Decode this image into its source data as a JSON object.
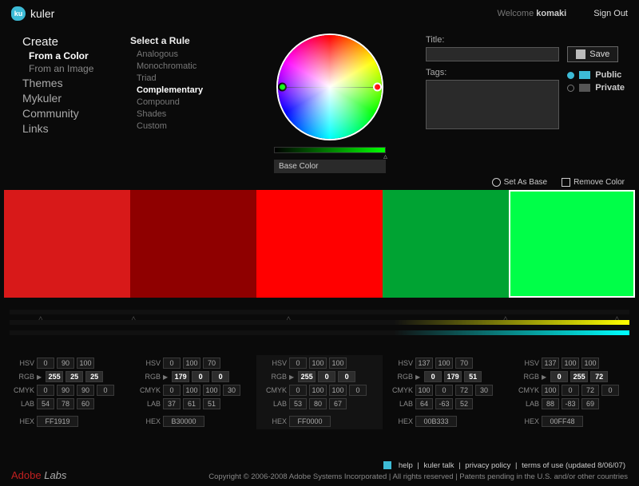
{
  "app": {
    "badge": "ku",
    "name": "kuler"
  },
  "user": {
    "welcome": "Welcome",
    "name": "komaki",
    "signout": "Sign Out"
  },
  "nav": {
    "create": "Create",
    "from_color": "From a Color",
    "from_image": "From an Image",
    "themes": "Themes",
    "mykuler": "Mykuler",
    "community": "Community",
    "links": "Links"
  },
  "rules": {
    "title": "Select a Rule",
    "items": [
      "Analogous",
      "Monochromatic",
      "Triad",
      "Complementary",
      "Compound",
      "Shades",
      "Custom"
    ],
    "active": 3
  },
  "base_color_label": "Base Color",
  "meta": {
    "title_label": "Title:",
    "tags_label": "Tags:",
    "title_value": "",
    "tags_value": "",
    "save": "Save",
    "public": "Public",
    "private": "Private"
  },
  "actions": {
    "set_base": "Set As Base",
    "remove": "Remove Color"
  },
  "swatches": [
    {
      "color": "#d81919"
    },
    {
      "color": "#8f0000"
    },
    {
      "color": "#ff0000"
    },
    {
      "color": "#00a333"
    },
    {
      "color": "#00ff48"
    }
  ],
  "base_index": 4,
  "value_labels": {
    "hsv": "HSV",
    "rgb": "RGB",
    "cmyk": "CMYK",
    "lab": "LAB",
    "hex": "HEX"
  },
  "cols": [
    {
      "hsv": [
        0,
        90,
        100
      ],
      "rgb": [
        255,
        25,
        25
      ],
      "cmyk": [
        0,
        90,
        90,
        0
      ],
      "lab": [
        54,
        78,
        60
      ],
      "hex": "FF1919"
    },
    {
      "hsv": [
        0,
        100,
        70
      ],
      "rgb": [
        179,
        0,
        0
      ],
      "cmyk": [
        0,
        100,
        100,
        30
      ],
      "lab": [
        37,
        61,
        51
      ],
      "hex": "B30000"
    },
    {
      "hsv": [
        0,
        100,
        100
      ],
      "rgb": [
        255,
        0,
        0
      ],
      "cmyk": [
        0,
        100,
        100,
        0
      ],
      "lab": [
        53,
        80,
        67
      ],
      "hex": "FF0000"
    },
    {
      "hsv": [
        137,
        100,
        70
      ],
      "rgb": [
        0,
        179,
        51
      ],
      "cmyk": [
        100,
        0,
        72,
        30
      ],
      "lab": [
        64,
        -63,
        52
      ],
      "hex": "00B333"
    },
    {
      "hsv": [
        137,
        100,
        100
      ],
      "rgb": [
        0,
        255,
        72
      ],
      "cmyk": [
        100,
        0,
        72,
        0
      ],
      "lab": [
        88,
        -83,
        69
      ],
      "hex": "00FF48"
    }
  ],
  "footer": {
    "brand_a": "Adobe",
    "brand_l": "Labs",
    "links": [
      "help",
      "kuler talk",
      "privacy policy",
      "terms of use (updated 8/06/07)"
    ],
    "copyright": "Copyright © 2006-2008 Adobe Systems Incorporated  |  All rights reserved  |  Patents pending in the U.S. and/or other countries"
  }
}
